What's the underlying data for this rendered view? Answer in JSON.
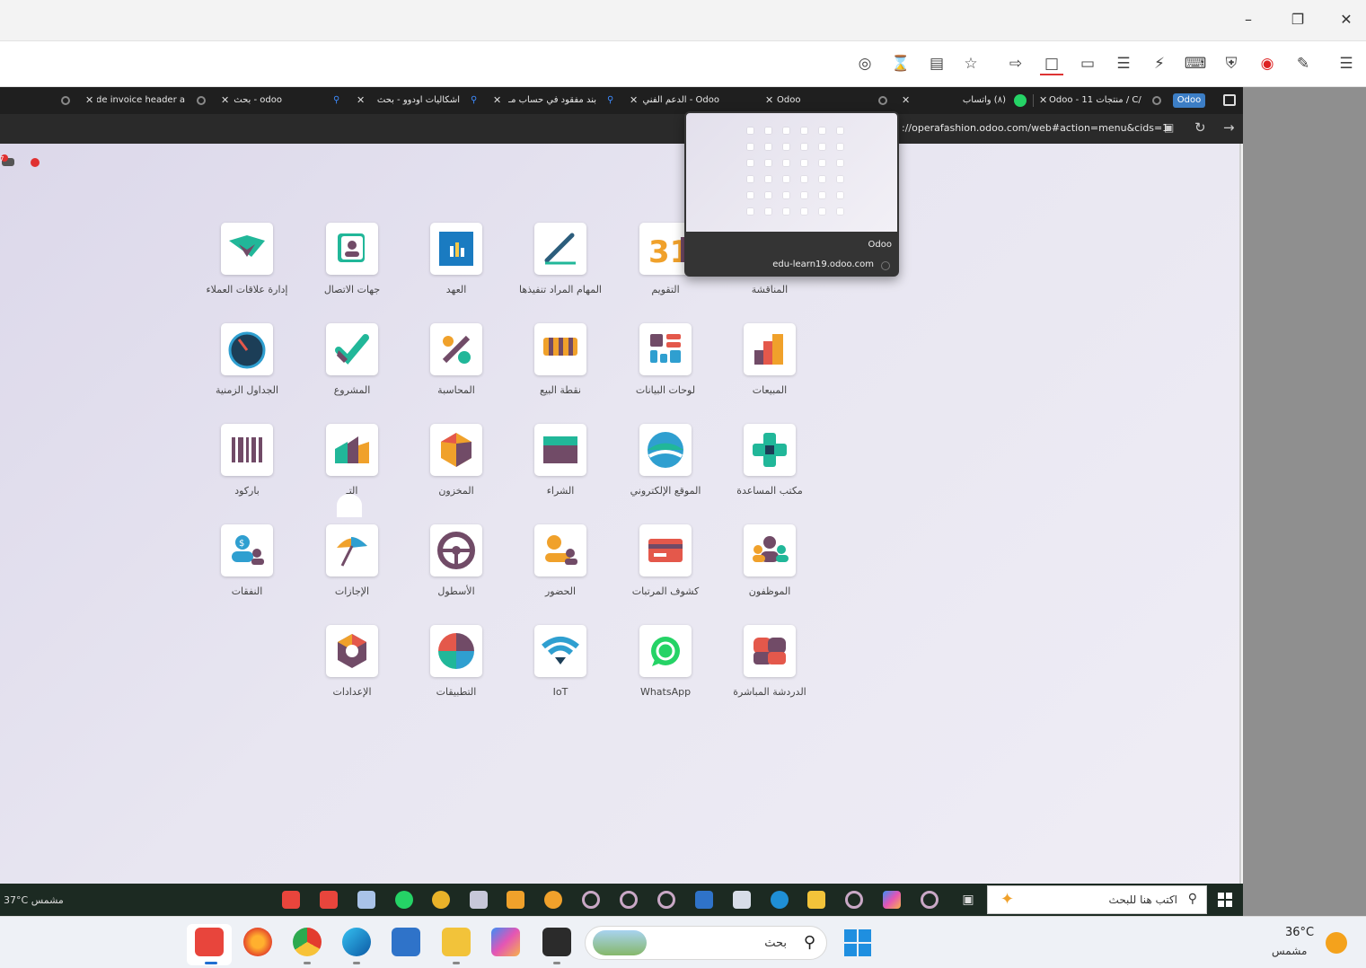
{
  "inner_tabs": [
    {
      "label": "Hide invoice header a"
    },
    {
      "label": "odoo - بحث"
    },
    {
      "label": "اشكاليات اودوو - بحث"
    },
    {
      "label": "بند مفقود في حساب مـ"
    },
    {
      "label": "Odoo - الدعم الفني"
    },
    {
      "label": "Odoo"
    },
    {
      "label": "(٨) واتساب"
    },
    {
      "label": "Odoo - 11 منتجات / C/"
    }
  ],
  "odoo_badge": "Odoo",
  "url": "://operafashion.odoo.com/web#action=menu&cids=1",
  "notification_count": "7",
  "apps": [
    {
      "label": "إدارة علاقات العملاء",
      "icon": "crm-icon"
    },
    {
      "label": "جهات الاتصال",
      "icon": "contacts-icon"
    },
    {
      "label": "العهد",
      "icon": "assets-icon"
    },
    {
      "label": "المهام المراد تنفيذها",
      "icon": "todo-icon"
    },
    {
      "label": "التقويم",
      "icon": "calendar-icon"
    },
    {
      "label": "المناقشة",
      "icon": "discuss-icon"
    },
    {
      "label": "الجداول الزمنية",
      "icon": "timesheets-icon"
    },
    {
      "label": "المشروع",
      "icon": "project-icon"
    },
    {
      "label": "المحاسبة",
      "icon": "accounting-icon"
    },
    {
      "label": "نقطة البيع",
      "icon": "pos-icon"
    },
    {
      "label": "لوحات البيانات",
      "icon": "dashboards-icon"
    },
    {
      "label": "المبيعات",
      "icon": "sales-icon"
    },
    {
      "label": "باركود",
      "icon": "barcode-icon"
    },
    {
      "label": "التـ",
      "icon": "manufacturing-icon"
    },
    {
      "label": "المخزون",
      "icon": "inventory-icon"
    },
    {
      "label": "الشراء",
      "icon": "purchase-icon"
    },
    {
      "label": "الموقع الإلكتروني",
      "icon": "website-icon"
    },
    {
      "label": "مكتب المساعدة",
      "icon": "helpdesk-icon"
    },
    {
      "label": "النفقات",
      "icon": "expenses-icon"
    },
    {
      "label": "الإجازات",
      "icon": "timeoff-icon"
    },
    {
      "label": "الأسطول",
      "icon": "fleet-icon"
    },
    {
      "label": "الحضور",
      "icon": "attendance-icon"
    },
    {
      "label": "كشوف المرتبات",
      "icon": "payroll-icon"
    },
    {
      "label": "الموظفون",
      "icon": "employees-icon"
    },
    {
      "label": "الإعدادات",
      "icon": "settings-icon"
    },
    {
      "label": "التطبيقات",
      "icon": "apps-icon"
    },
    {
      "label": "IoT",
      "icon": "iot-icon"
    },
    {
      "label": "WhatsApp",
      "icon": "whatsapp-icon"
    },
    {
      "label": "الدردشة المباشرة",
      "icon": "livechat-icon"
    }
  ],
  "tab_preview": {
    "title": "Odoo",
    "url": "edu-learn19.odoo.com"
  },
  "inner_taskbar": {
    "search_placeholder": "اكتب هنا للبحث",
    "weather": "37°C  مشمس"
  },
  "outer_taskbar": {
    "search_placeholder": "بحث",
    "temperature": "36°C",
    "weather_desc": "مشمس"
  },
  "colors": {
    "odoo_purple": "#714b67",
    "teal": "#21b799",
    "accent_blue": "#3c7ec6"
  }
}
